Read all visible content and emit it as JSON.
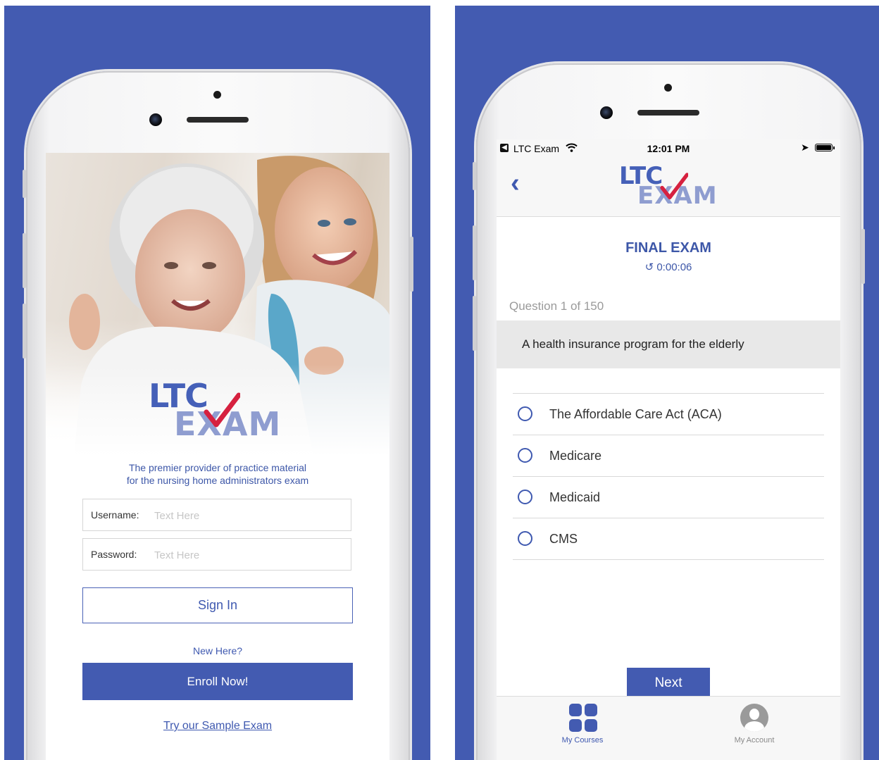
{
  "login": {
    "logo_top": "LTC",
    "logo_bottom": "EXAM",
    "tagline_line1": "The premier provider of practice material",
    "tagline_line2": "for the nursing home administrators exam",
    "username_label": "Username:",
    "username_placeholder": "Text Here",
    "password_label": "Password:",
    "password_placeholder": "Text Here",
    "signin_label": "Sign In",
    "new_here": "New Here?",
    "enroll_label": "Enroll Now!",
    "sample_link": "Try our Sample Exam"
  },
  "exam": {
    "status": {
      "app": "LTC Exam",
      "time": "12:01 PM"
    },
    "logo_top": "LTC",
    "logo_bottom": "EXAM",
    "title": "FINAL EXAM",
    "timer": "0:00:06",
    "question_number": "Question 1 of 150",
    "question_text": "A health insurance program for the elderly",
    "options": [
      "The Affordable Care Act (ACA)",
      "Medicare",
      "Medicaid",
      "CMS"
    ],
    "next_label": "Next",
    "tabs": [
      {
        "label": "My Courses",
        "active": true
      },
      {
        "label": "My Account",
        "active": false
      }
    ]
  },
  "colors": {
    "brand_blue": "#435bb1",
    "logo_light": "#8f9dd0",
    "check_red": "#d6213f"
  }
}
